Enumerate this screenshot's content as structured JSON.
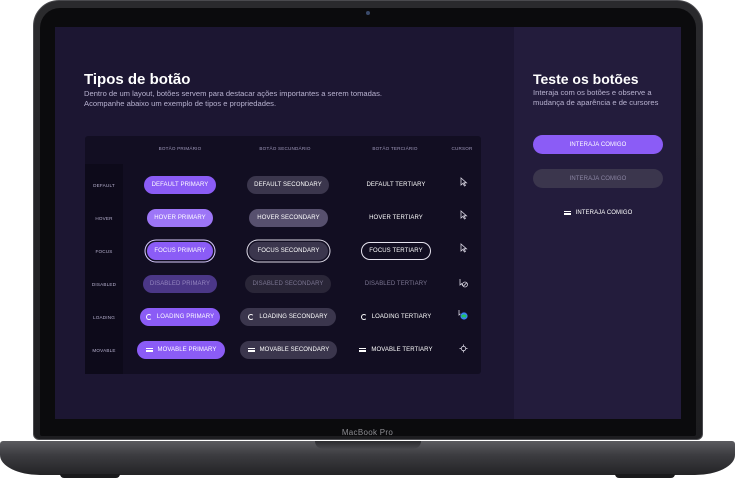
{
  "device": {
    "label": "MacBook Pro"
  },
  "header": {
    "title": "Tipos de botão",
    "description": "Dentro de um layout, botões servem para destacar ações importantes a serem tomadas. Acompanhe abaixo um exemplo de tipos e propriedades."
  },
  "table": {
    "columns": [
      "BOTÃO PRIMÁRIO",
      "BOTÃO SECUNDÁRIO",
      "BOTÃO TERCIÁRIO",
      "CURSOR"
    ],
    "rows": [
      {
        "label": "DEFAULT",
        "primary": "DEFAULT PRIMARY",
        "secondary": "DEFAULT SECONDARY",
        "tertiary": "DEFAULT TERTIARY",
        "cursor": "arrow-cursor-icon"
      },
      {
        "label": "HOVER",
        "primary": "HOVER PRIMARY",
        "secondary": "HOVER SECONDARY",
        "tertiary": "HOVER TERTIARY",
        "cursor": "arrow-cursor-icon"
      },
      {
        "label": "FOCUS",
        "primary": "FOCUS PRIMARY",
        "secondary": "FOCUS SECONDARY",
        "tertiary": "FOCUS TERTIARY",
        "cursor": "arrow-cursor-icon"
      },
      {
        "label": "DISABLED",
        "primary": "DISABLED PRIMARY",
        "secondary": "DISABLED SECONDARY",
        "tertiary": "DISABLED TERTIARY",
        "cursor": "not-allowed-cursor-icon"
      },
      {
        "label": "LOADING",
        "primary": "LOADING PRIMARY",
        "secondary": "LOADING SECONDARY",
        "tertiary": "LOADING TERTIARY",
        "cursor": "progress-cursor-icon"
      },
      {
        "label": "MOVABLE",
        "primary": "MOVABLE PRIMARY",
        "secondary": "MOVABLE SECONDARY",
        "tertiary": "MOVABLE TERTIARY",
        "cursor": "move-cursor-icon"
      }
    ]
  },
  "try_panel": {
    "title": "Teste os botões",
    "description": "Interaja com os botões e observe a mudança de aparência e de cursores",
    "primary_label": "INTERAJA COMIGO",
    "secondary_label": "INTERAJA COMIGO",
    "tertiary_label": "INTERAJA COMIGO"
  },
  "colors": {
    "accent": "#8b5cf6",
    "background": "#1c1632",
    "panel": "#231c3c"
  }
}
